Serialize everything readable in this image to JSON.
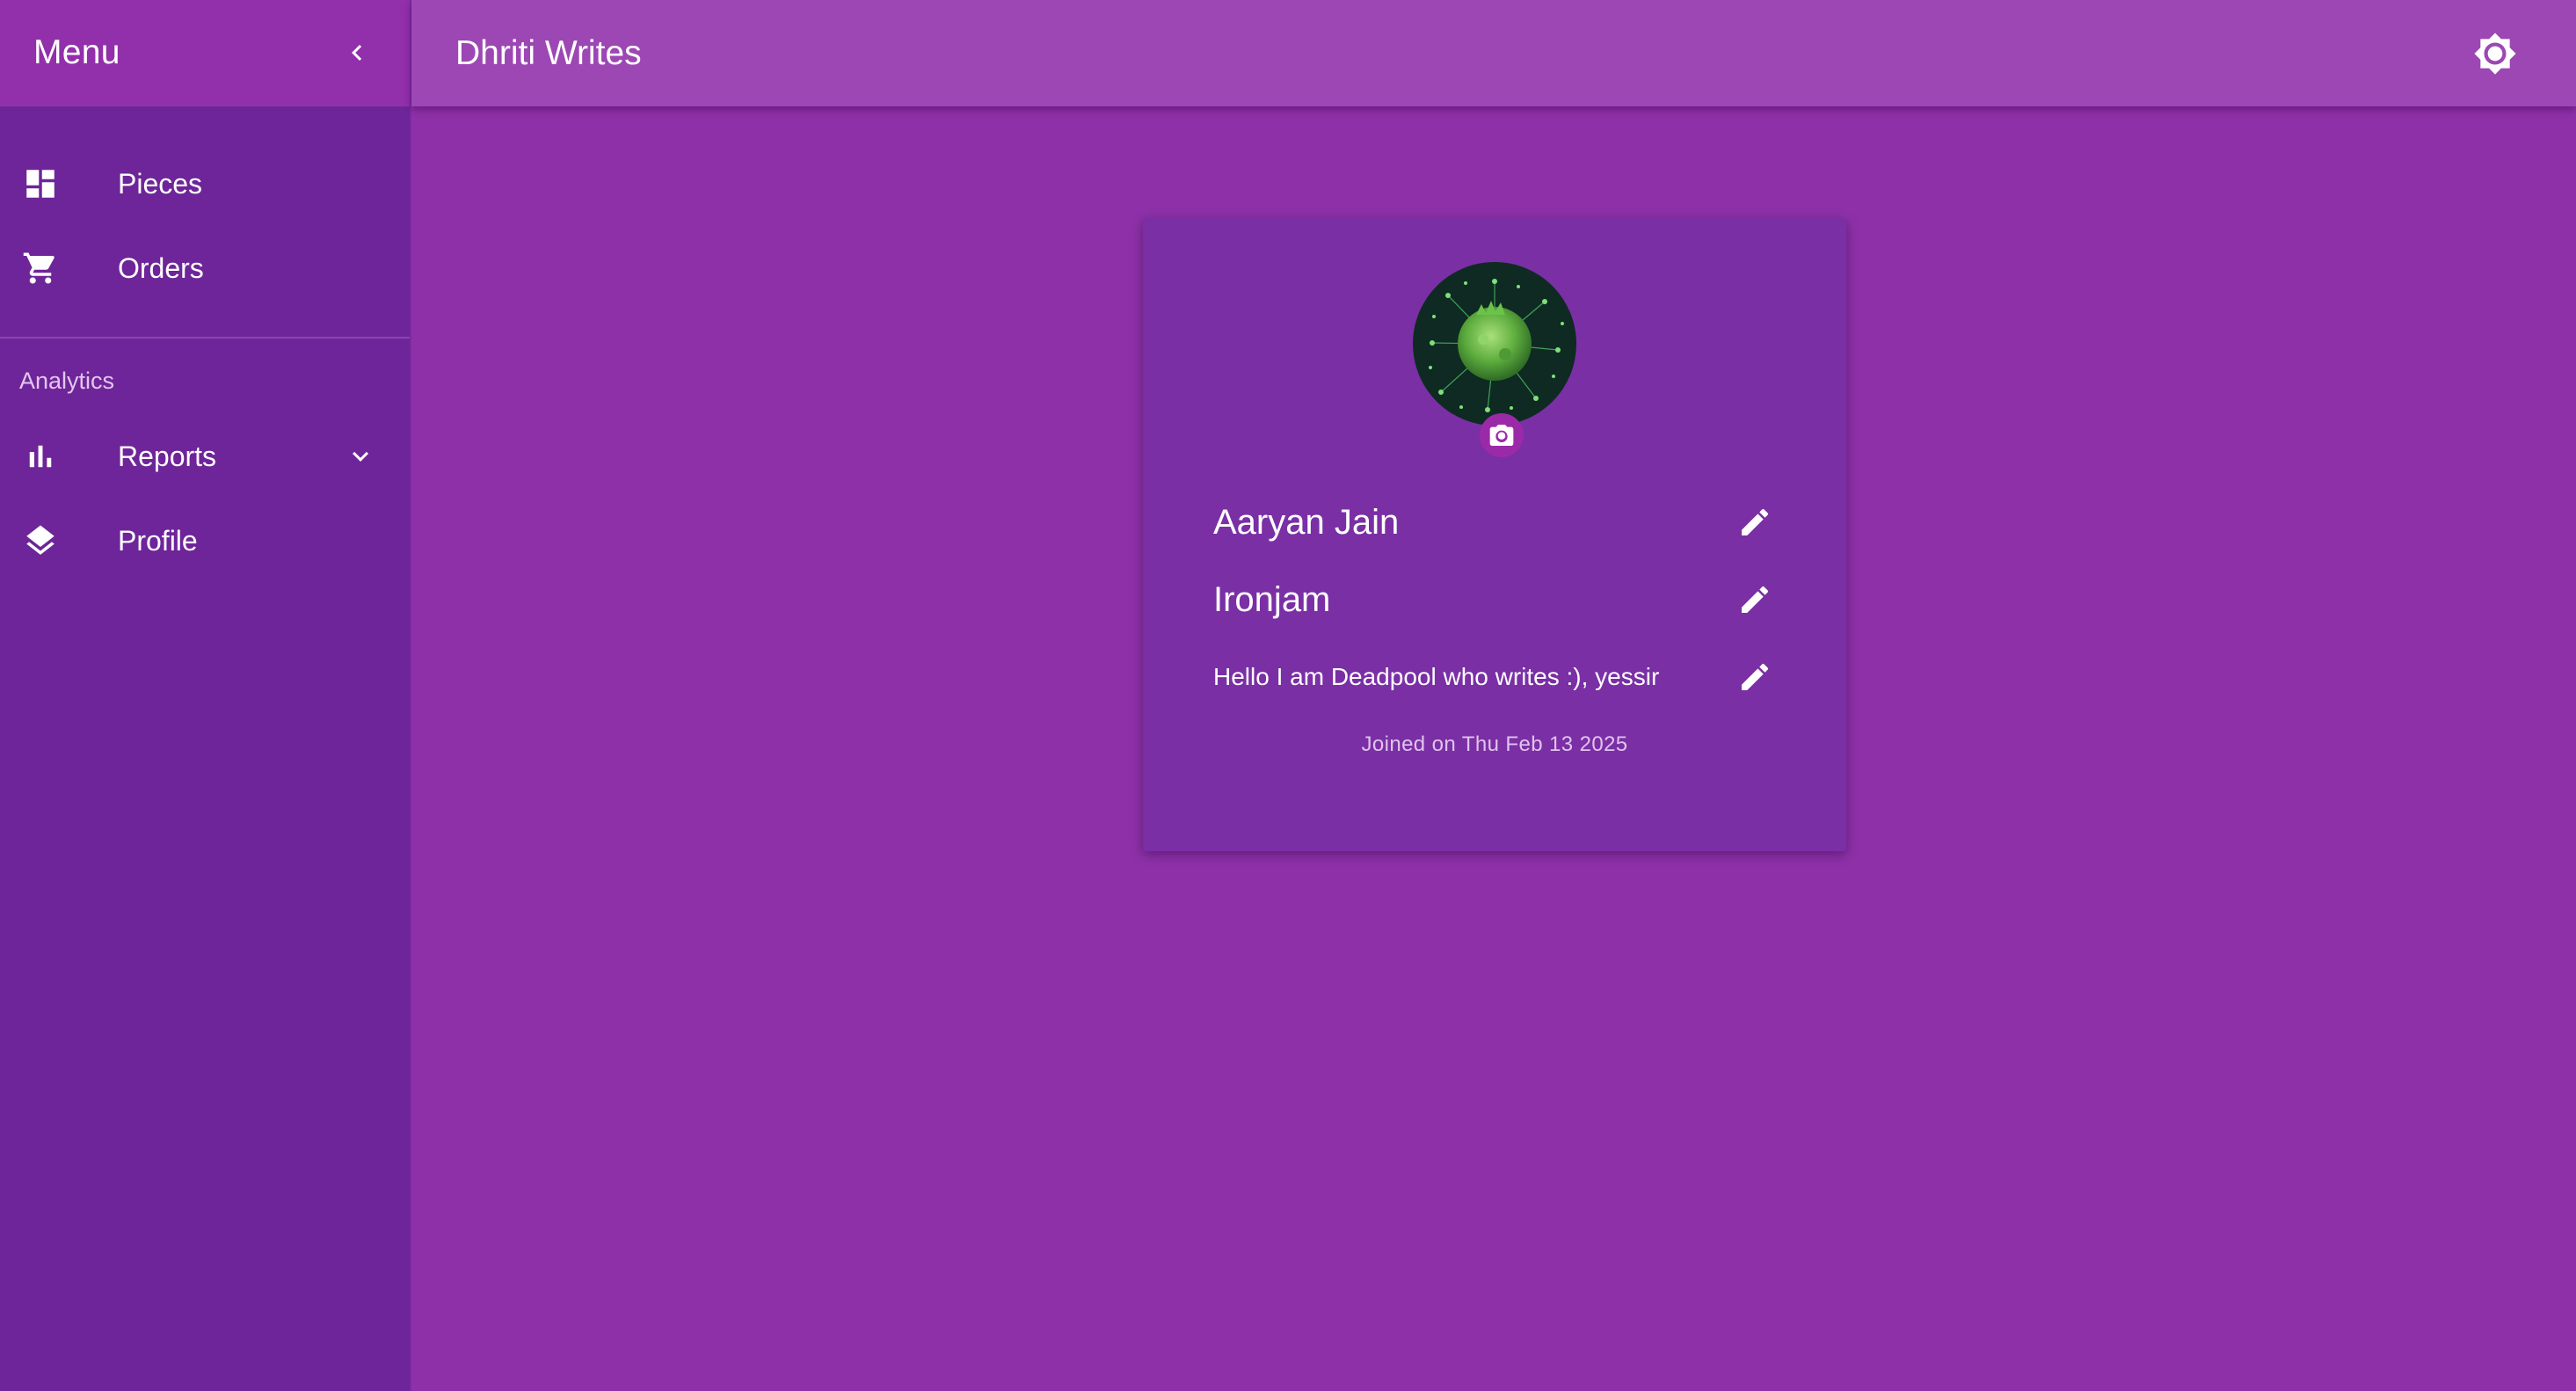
{
  "sidebar": {
    "title": "Menu",
    "items": [
      {
        "label": "Pieces",
        "icon": "dashboard-icon"
      },
      {
        "label": "Orders",
        "icon": "cart-icon"
      }
    ],
    "section_label": "Analytics",
    "analytics_items": [
      {
        "label": "Reports",
        "icon": "bar-chart-icon"
      },
      {
        "label": "Profile",
        "icon": "layers-icon"
      }
    ]
  },
  "appbar": {
    "title": "Dhriti Writes",
    "theme_icon": "brightness-icon"
  },
  "profile": {
    "name": "Aaryan Jain",
    "username": "Ironjam",
    "bio": "Hello I am Deadpool who writes :), yessir",
    "joined": "Joined on Thu Feb 13 2025"
  },
  "colors": {
    "background": "#8e31a9",
    "sidebar": "#6e2599",
    "appbar": "#9c47b3",
    "card": "#7a2fa5",
    "camera_button": "#9b2aa9"
  }
}
